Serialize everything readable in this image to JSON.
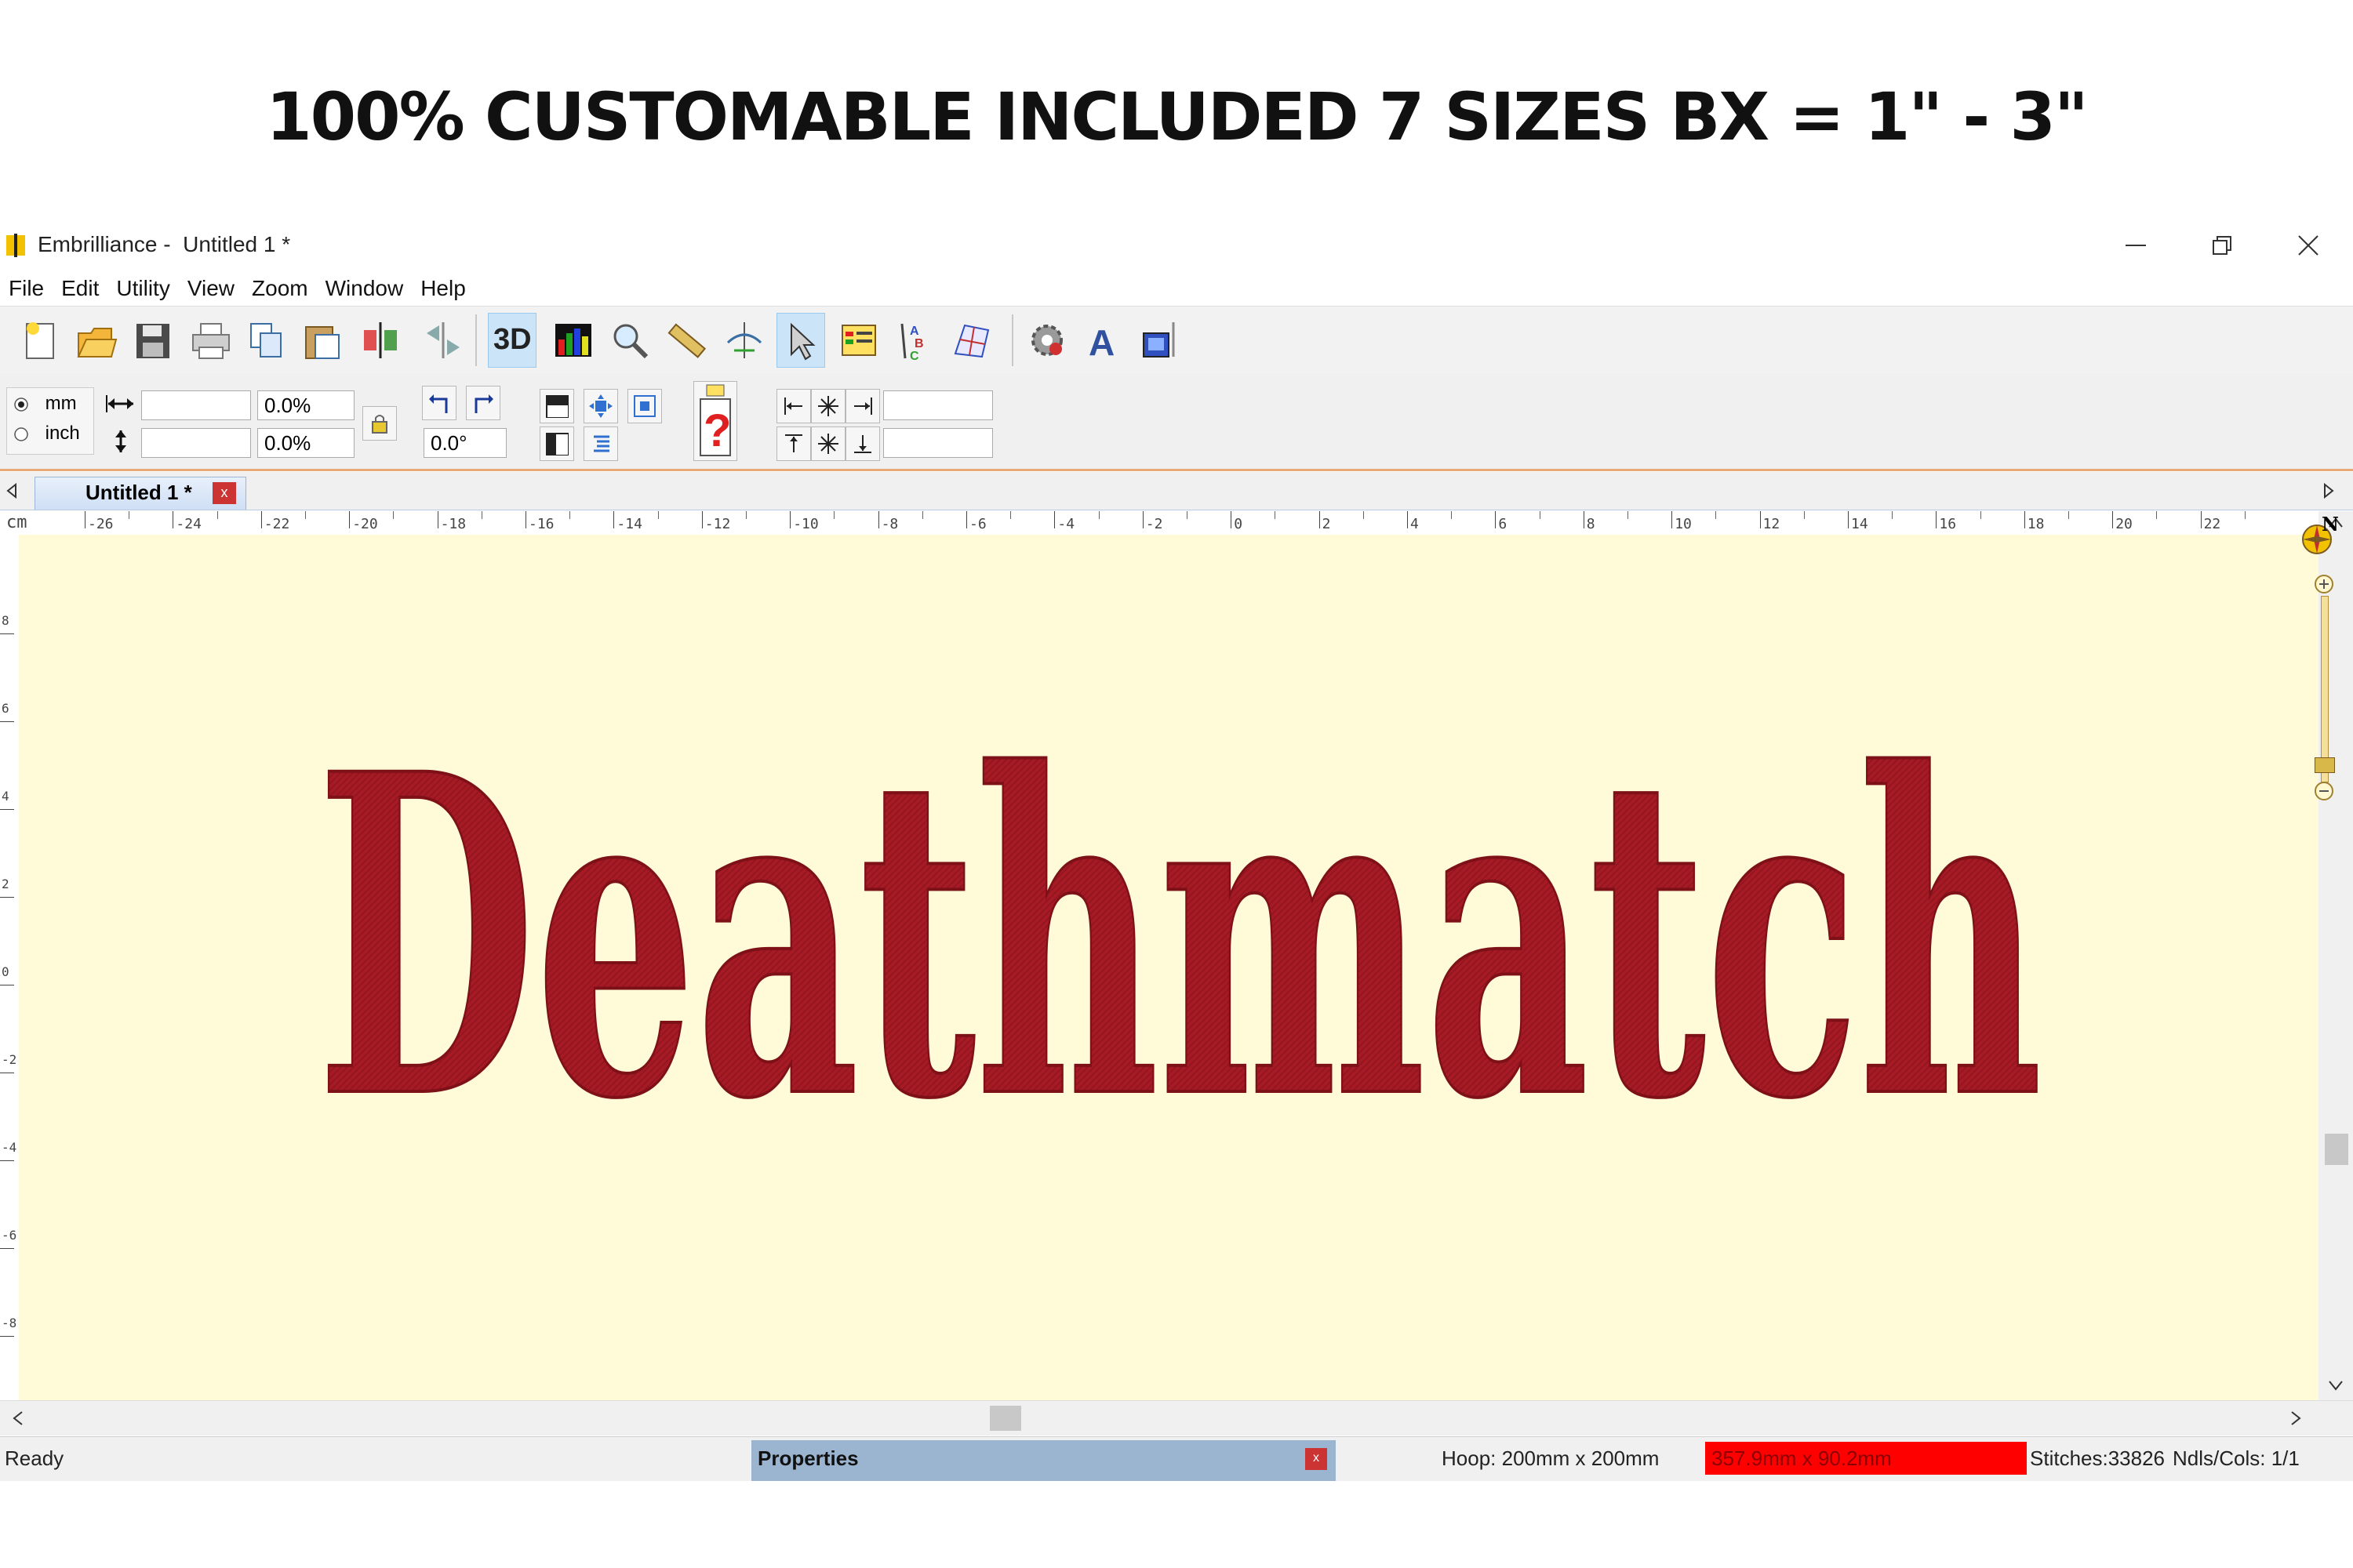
{
  "headline": "100% CUSTOMABLE INCLUDED 7 SIZES BX = 1\" - 3\"",
  "window": {
    "app_name": "Embrilliance -  Untitled 1 *"
  },
  "menu": [
    "File",
    "Edit",
    "Utility",
    "View",
    "Zoom",
    "Window",
    "Help"
  ],
  "toolbar": {
    "icons": [
      "new-file-icon",
      "open-folder-icon",
      "save-icon",
      "print-icon",
      "copy-icon",
      "paste-icon",
      "mirror-vertical-icon",
      "mirror-horizontal-icon",
      "3d-view-icon",
      "color-sort-icon",
      "zoom-icon",
      "measure-icon",
      "stitch-player-icon",
      "select-pointer-icon",
      "properties-panel-icon",
      "spell-text-icon",
      "fabric-grid-icon",
      "settings-gear-icon",
      "text-tool-icon",
      "sew-simulator-icon"
    ],
    "three_d_label": "3D"
  },
  "units": {
    "mm_label": "mm",
    "inch_label": "inch",
    "selected": "mm"
  },
  "props": {
    "width_value": "",
    "height_value": "",
    "width_pct": "0.0%",
    "height_pct": "0.0%",
    "rotation": "0.0°",
    "spacing_top": "",
    "spacing_bottom": ""
  },
  "tab": {
    "label": "Untitled 1 *",
    "close": "x"
  },
  "ruler": {
    "unit": "cm",
    "labels": [
      "-26",
      "-24",
      "-22",
      "-20",
      "-18",
      "-16",
      "-14",
      "-12",
      "-10",
      "-8",
      "-6",
      "-4",
      "-2",
      "0",
      "2",
      "4",
      "6",
      "8",
      "10",
      "12",
      "14",
      "16",
      "18",
      "20",
      "22"
    ],
    "v_labels": [
      "8",
      "6",
      "4",
      "2",
      "0",
      "-2",
      "-4",
      "-6",
      "-8"
    ],
    "compass_label": "N"
  },
  "design": {
    "text": "Deathmatch",
    "color": "#a61a24"
  },
  "colors": {
    "canvas": "#fffbd8",
    "design": "#a61a24",
    "size_highlight": "#ff0000"
  },
  "status": {
    "ready": "Ready",
    "properties_title": "Properties",
    "properties_close": "x",
    "hoop": "Hoop: 200mm x 200mm",
    "design_size": "357.9mm x 90.2mm",
    "stitches": "Stitches:33826",
    "needles": "Ndls/Cols: 1/1"
  }
}
